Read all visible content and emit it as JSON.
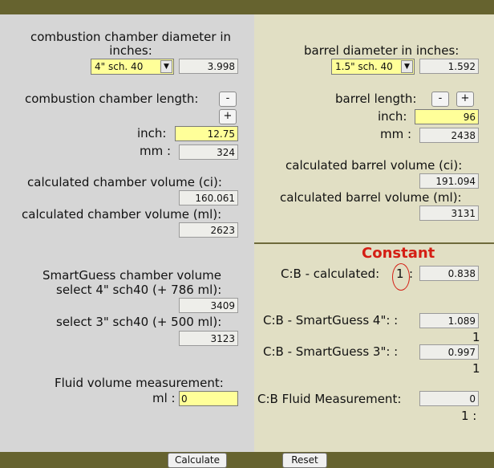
{
  "left": {
    "cc_diameter_label": "combustion chamber diameter in inches:",
    "cc_diameter_select": "4\" sch. 40",
    "cc_diameter_value": "3.998",
    "cc_length_label": "combustion chamber length:",
    "minus": "-",
    "plus": "+",
    "inch_label": "inch:",
    "cc_inch_value": "12.75",
    "mm_label": "mm :",
    "cc_mm_value": "324",
    "calc_ci_label": "calculated chamber volume (ci):",
    "calc_ci_value": "160.061",
    "calc_ml_label": "calculated chamber volume (ml):",
    "calc_ml_value": "2623",
    "smartguess_label": "SmartGuess chamber volume",
    "select4_label": "select 4\" sch40 (+ 786 ml):",
    "select4_value": "3409",
    "select3_label": "select 3\" sch40 (+ 500 ml):",
    "select3_value": "3123",
    "fluid_label": "Fluid volume measurement:",
    "ml_label": "ml :",
    "fluid_value": "0"
  },
  "right": {
    "barrel_diameter_label": "barrel diameter in inches:",
    "barrel_select": "1.5\" sch. 40",
    "barrel_diameter_value": "1.592",
    "barrel_length_label": "barrel length:",
    "minus": "-",
    "plus": "+",
    "inch_label": "inch:",
    "barrel_inch_value": "96",
    "mm_label": "mm :",
    "barrel_mm_value": "2438",
    "calc_ci_label": "calculated barrel volume (ci):",
    "calc_ci_value": "191.094",
    "calc_ml_label": "calculated barrel volume (ml):",
    "calc_ml_value": "3131",
    "constant_label": "Constant",
    "cb_calc_label": "C:B - calculated:",
    "cb_calc_one": "1",
    "colon": ":",
    "cb_calc_value": "0.838",
    "cb_sg4_label": "C:B - SmartGuess 4\": :",
    "cb_sg4_value": "1.089",
    "cb_sg4_one": "1",
    "cb_sg3_label": "C:B - SmartGuess 3\": :",
    "cb_sg3_value": "0.997",
    "cb_sg3_one": "1",
    "cb_fluid_label": "C:B Fluid Measurement:",
    "cb_fluid_value": "0",
    "cb_fluid_one": "1 :"
  },
  "footer": {
    "calculate": "Calculate",
    "reset": "Reset"
  },
  "colors": {
    "frame": "#66632f",
    "left_panel": "#d6d6d6",
    "right_panel": "#e1dfc4",
    "input_yellow": "#ffff99",
    "accent_red": "#d41e14"
  }
}
